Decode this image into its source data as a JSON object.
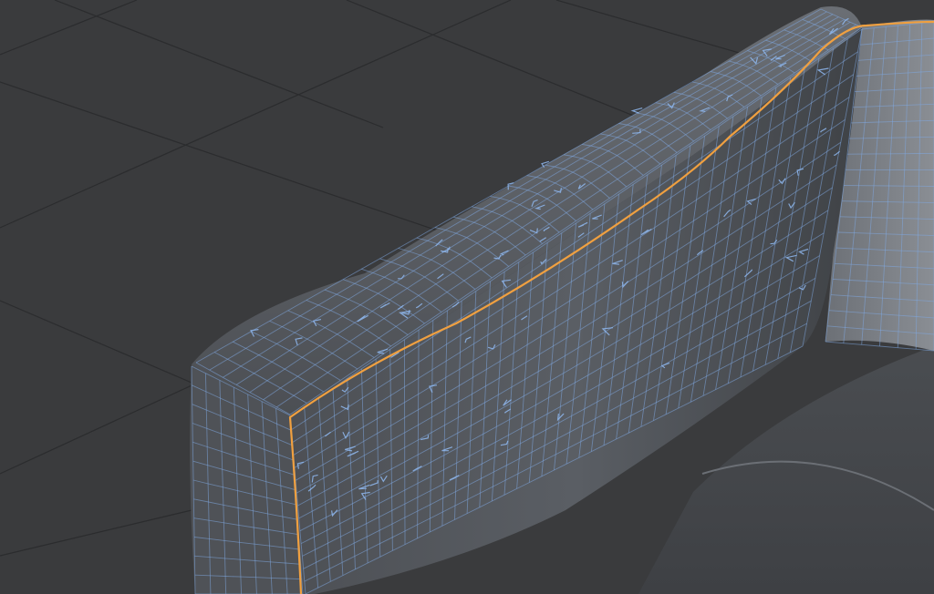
{
  "viewport": {
    "mode": "wireframe-on-shaded",
    "object": "armchair-backrest",
    "colors": {
      "background": "#3a3b3d",
      "floor_grid": "#2b2c2e",
      "surface": "#55585d",
      "surface_dark": "#45484c",
      "wireframe": "#7fa8e0",
      "selected_edge": "#f0a040"
    }
  }
}
